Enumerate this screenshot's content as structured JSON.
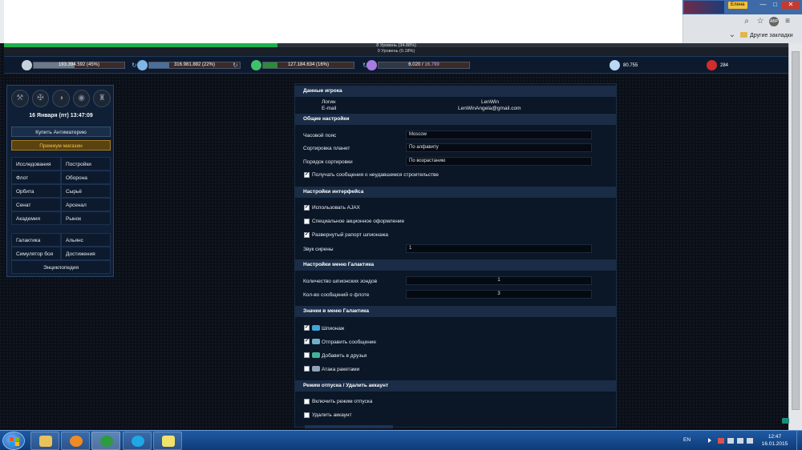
{
  "browser": {
    "user_name": "Елена",
    "bookmarks": {
      "other_label": "Другие закладки"
    },
    "controls": {
      "minimize": "—",
      "maximize": "□",
      "close": "✕",
      "expand": "⌄"
    },
    "icons": {
      "search": "⌕",
      "star": "☆",
      "adblock": "ABP",
      "menu": "≡"
    }
  },
  "levels": {
    "primary": {
      "label": "8 Уровень (34.88%)",
      "progress": 0.3488
    },
    "secondary": {
      "label": "0 Уровень (0.18%)",
      "progress": 0.0018
    }
  },
  "resources": [
    {
      "name": "metal",
      "text": "193.394.592 (45%)",
      "fill": 0.45,
      "color": "#6d7a8a",
      "icon_color": "#c7d1db",
      "refresh": "↻"
    },
    {
      "name": "crystal",
      "text": "316.981.882 (22%)",
      "fill": 0.22,
      "color": "#4a6f9c",
      "icon_color": "#7fb7e6",
      "refresh": "↻"
    },
    {
      "name": "deuterium",
      "text": "127.184.634 (16%)",
      "fill": 0.16,
      "color": "#2f8a3a",
      "icon_color": "#3fc16a",
      "refresh": "↻"
    },
    {
      "name": "energy",
      "text_used": "6.020",
      "text_sep": " / ",
      "text_max": "16.799",
      "fill": 0.36,
      "color": "#303846",
      "icon_color": "#a77be0"
    }
  ],
  "resources_simple": [
    {
      "name": "darkmatter",
      "value": "80.755",
      "icon_color": "#b9d8f5"
    },
    {
      "name": "antimatter",
      "value": "284",
      "icon_color": "#d22c2c"
    }
  ],
  "sidebar": {
    "date": "16 Января (пт) 13:47:09",
    "icons": [
      "⚒",
      "✠",
      "◑",
      "◉",
      "♜"
    ],
    "buy_antimatter": "Купить Антиматерию",
    "premium_shop": "Премиум магазин",
    "links_1": [
      "Исследования",
      "Постройки",
      "Флот",
      "Оборона",
      "Орбита",
      "Сырьё",
      "Сенат",
      "Арсенал",
      "Академия",
      "Рынок"
    ],
    "links_2": [
      "Галактика",
      "Альянс",
      "Симулятор боя",
      "Достижения"
    ],
    "encyclopedia": "Энциклопедия"
  },
  "settings": {
    "player_data": {
      "header": "Данные игрока",
      "login_label": "Логин",
      "login_value": "LenWin",
      "email_label": "E-mail",
      "email_value": "LenWinAngela@gmail.com"
    },
    "general": {
      "header": "Общие настройки",
      "timezone_label": "Часовой пояс",
      "timezone_value": "Moscow",
      "sort_label": "Сортировка планет",
      "sort_value": "По алфавиту",
      "order_label": "Порядок сортировки",
      "order_value": "По возрастанию",
      "failed_build_label": "Получать сообщения о неудавшемся строительстве",
      "failed_build_checked": true
    },
    "interface": {
      "header": "Настройки интерфейса",
      "ajax_label": "Использовать AJAX",
      "ajax_checked": true,
      "promo_label": "Специальное акционное оформление",
      "promo_checked": false,
      "spy_report_label": "Развернутый рапорт шпионажа",
      "spy_report_checked": true,
      "siren_label": "Звук сирены",
      "siren_value": "1"
    },
    "galaxy_menu": {
      "header": "Настройки меню Галактика",
      "probes_label": "Количество шпионских зондов",
      "probes_value": "1",
      "fleet_msgs_label": "Кол-во сообщений о флоте",
      "fleet_msgs_value": "3"
    },
    "galaxy_icons": {
      "header": "Значки в меню Галактика",
      "items": [
        {
          "label": "Шпионаж",
          "checked": true,
          "icon_color": "#3fa6d8"
        },
        {
          "label": "Отправить сообщение",
          "checked": true,
          "icon_color": "#6fb0c8"
        },
        {
          "label": "Добавить в друзья",
          "checked": false,
          "icon_color": "#3fb39a"
        },
        {
          "label": "Атака ракетами",
          "checked": false,
          "icon_color": "#8fa3b6"
        }
      ]
    },
    "vacation": {
      "header": "Режим отпуска / Удалить аккаунт",
      "vacation_label": "Включить режим отпуска",
      "vacation_checked": false,
      "delete_label": "Удалить аккаунт",
      "delete_checked": false
    }
  },
  "taskbar": {
    "language": "EN",
    "time": "12:47",
    "date": "16.01.2015",
    "apps": [
      {
        "name": "explorer",
        "color": "#e8c25a"
      },
      {
        "name": "media-player",
        "color": "#f08a24"
      },
      {
        "name": "chrome",
        "color": "#2f9b3f"
      },
      {
        "name": "skype",
        "color": "#1fa7e6"
      },
      {
        "name": "sticky-notes",
        "color": "#f2e16b"
      }
    ]
  }
}
